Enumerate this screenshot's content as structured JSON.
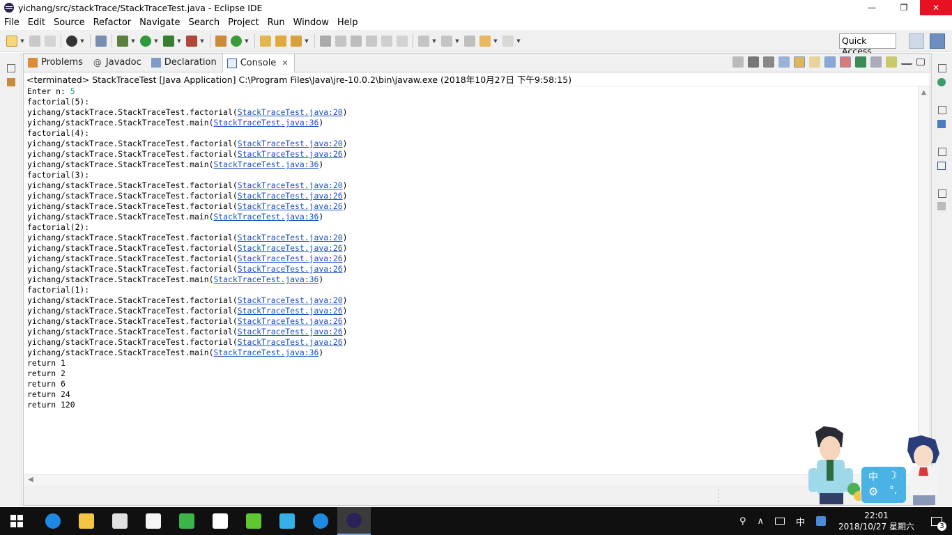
{
  "window": {
    "title": "yichang/src/stackTrace/StackTraceTest.java - Eclipse IDE",
    "minimize": "—",
    "maximize": "❐",
    "close": "✕"
  },
  "menu": [
    "File",
    "Edit",
    "Source",
    "Refactor",
    "Navigate",
    "Search",
    "Project",
    "Run",
    "Window",
    "Help"
  ],
  "toolbar": {
    "quick_access": "Quick Access"
  },
  "tabs": {
    "problems": "Problems",
    "javadoc": "Javadoc",
    "declaration": "Declaration",
    "console": "Console",
    "close_glyph": "✕"
  },
  "console": {
    "header": "<terminated> StackTraceTest [Java Application] C:\\Program Files\\Java\\jre-10.0.2\\bin\\javaw.exe (2018年10月27日 下午9:58:15)",
    "lines": [
      {
        "t": "Enter n: ",
        "in": "5"
      },
      {
        "t": "factorial(5):"
      },
      {
        "t": "yichang/stackTrace.StackTraceTest.factorial(",
        "l": "StackTraceTest.java:20",
        "e": ")"
      },
      {
        "t": "yichang/stackTrace.StackTraceTest.main(",
        "l": "StackTraceTest.java:36",
        "e": ")"
      },
      {
        "t": "factorial(4):"
      },
      {
        "t": "yichang/stackTrace.StackTraceTest.factorial(",
        "l": "StackTraceTest.java:20",
        "e": ")"
      },
      {
        "t": "yichang/stackTrace.StackTraceTest.factorial(",
        "l": "StackTraceTest.java:26",
        "e": ")"
      },
      {
        "t": "yichang/stackTrace.StackTraceTest.main(",
        "l": "StackTraceTest.java:36",
        "e": ")"
      },
      {
        "t": "factorial(3):"
      },
      {
        "t": "yichang/stackTrace.StackTraceTest.factorial(",
        "l": "StackTraceTest.java:20",
        "e": ")"
      },
      {
        "t": "yichang/stackTrace.StackTraceTest.factorial(",
        "l": "StackTraceTest.java:26",
        "e": ")"
      },
      {
        "t": "yichang/stackTrace.StackTraceTest.factorial(",
        "l": "StackTraceTest.java:26",
        "e": ")"
      },
      {
        "t": "yichang/stackTrace.StackTraceTest.main(",
        "l": "StackTraceTest.java:36",
        "e": ")"
      },
      {
        "t": "factorial(2):"
      },
      {
        "t": "yichang/stackTrace.StackTraceTest.factorial(",
        "l": "StackTraceTest.java:20",
        "e": ")"
      },
      {
        "t": "yichang/stackTrace.StackTraceTest.factorial(",
        "l": "StackTraceTest.java:26",
        "e": ")"
      },
      {
        "t": "yichang/stackTrace.StackTraceTest.factorial(",
        "l": "StackTraceTest.java:26",
        "e": ")"
      },
      {
        "t": "yichang/stackTrace.StackTraceTest.factorial(",
        "l": "StackTraceTest.java:26",
        "e": ")"
      },
      {
        "t": "yichang/stackTrace.StackTraceTest.main(",
        "l": "StackTraceTest.java:36",
        "e": ")"
      },
      {
        "t": "factorial(1):"
      },
      {
        "t": "yichang/stackTrace.StackTraceTest.factorial(",
        "l": "StackTraceTest.java:20",
        "e": ")"
      },
      {
        "t": "yichang/stackTrace.StackTraceTest.factorial(",
        "l": "StackTraceTest.java:26",
        "e": ")"
      },
      {
        "t": "yichang/stackTrace.StackTraceTest.factorial(",
        "l": "StackTraceTest.java:26",
        "e": ")"
      },
      {
        "t": "yichang/stackTrace.StackTraceTest.factorial(",
        "l": "StackTraceTest.java:26",
        "e": ")"
      },
      {
        "t": "yichang/stackTrace.StackTraceTest.factorial(",
        "l": "StackTraceTest.java:26",
        "e": ")"
      },
      {
        "t": "yichang/stackTrace.StackTraceTest.main(",
        "l": "StackTraceTest.java:36",
        "e": ")"
      },
      {
        "t": "return 1"
      },
      {
        "t": "return 2"
      },
      {
        "t": "return 6"
      },
      {
        "t": "return 24"
      },
      {
        "t": "return 120"
      }
    ]
  },
  "ime": {
    "lang": "中",
    "moon": "☽",
    "gear": "⚙",
    "dots": "°,"
  },
  "taskbar": {
    "apps": [
      {
        "name": "edge-icon",
        "color": "#1e88e5"
      },
      {
        "name": "file-explorer-icon",
        "color": "#f4c542"
      },
      {
        "name": "store-icon",
        "color": "#e0e0e0"
      },
      {
        "name": "qq-icon",
        "color": "#f5f5f5"
      },
      {
        "name": "green-app-icon",
        "color": "#39b54a"
      },
      {
        "name": "mail-icon",
        "color": "#ffffff"
      },
      {
        "name": "iqiyi-icon",
        "color": "#5dc72f"
      },
      {
        "name": "video-player-icon",
        "color": "#35b0e8"
      },
      {
        "name": "ie-icon",
        "color": "#1e8be0"
      },
      {
        "name": "eclipse-icon",
        "color": "#2c2255"
      }
    ],
    "tray": {
      "people": "⚲",
      "chevron": "∧",
      "ime_mode": "中",
      "time": "22:01",
      "date": "2018/10/27 星期六",
      "notifications": "3"
    }
  }
}
